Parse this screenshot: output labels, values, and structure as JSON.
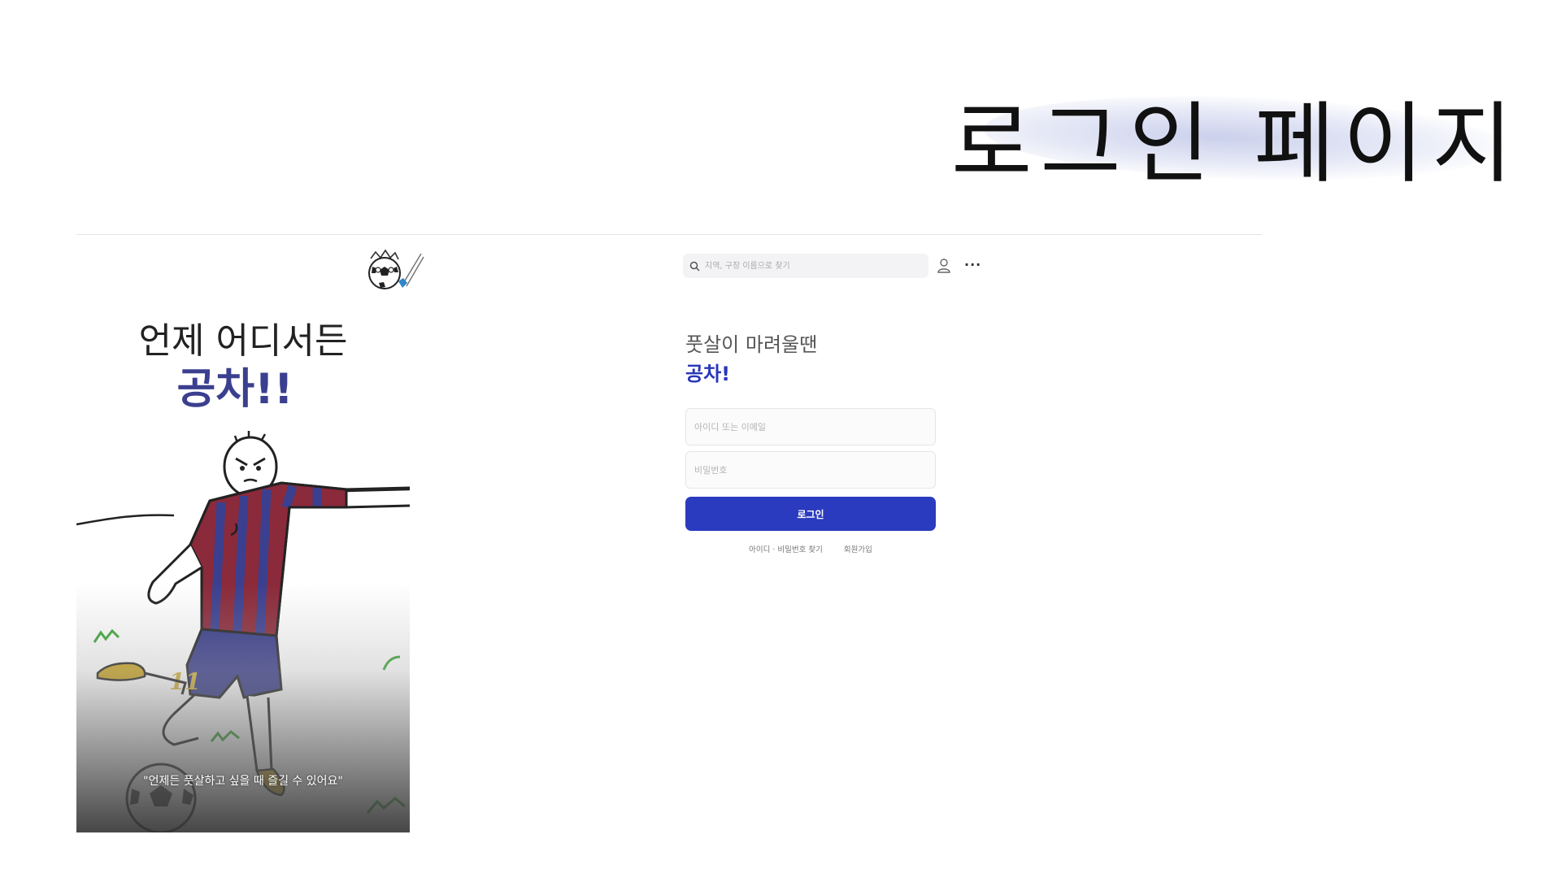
{
  "slide": {
    "title": "로그인 페이지"
  },
  "header": {
    "search_placeholder": "지역, 구장 이름으로 찾기",
    "more_label": "···"
  },
  "illustration": {
    "headline_line1": "언제 어디서든",
    "headline_line2": "공차!!",
    "jersey_number": "11",
    "tagline": "\"언제든 풋살하고 싶을 때 즐길 수 있어요\""
  },
  "login": {
    "subheading": "풋살이 마려울땐",
    "brand": "공차!",
    "id_placeholder": "아이디 또는 이메일",
    "password_placeholder": "비밀번호",
    "login_button": "로그인",
    "find_link": "아이디 · 비밀번호 찾기",
    "signup_link": "회원가입"
  },
  "colors": {
    "brand_blue": "#2b3bbf",
    "brand_text": "#2736b8",
    "jersey_red": "#8b2a3a",
    "jersey_blue": "#3b3f8f",
    "grass_green": "#3aa535"
  }
}
